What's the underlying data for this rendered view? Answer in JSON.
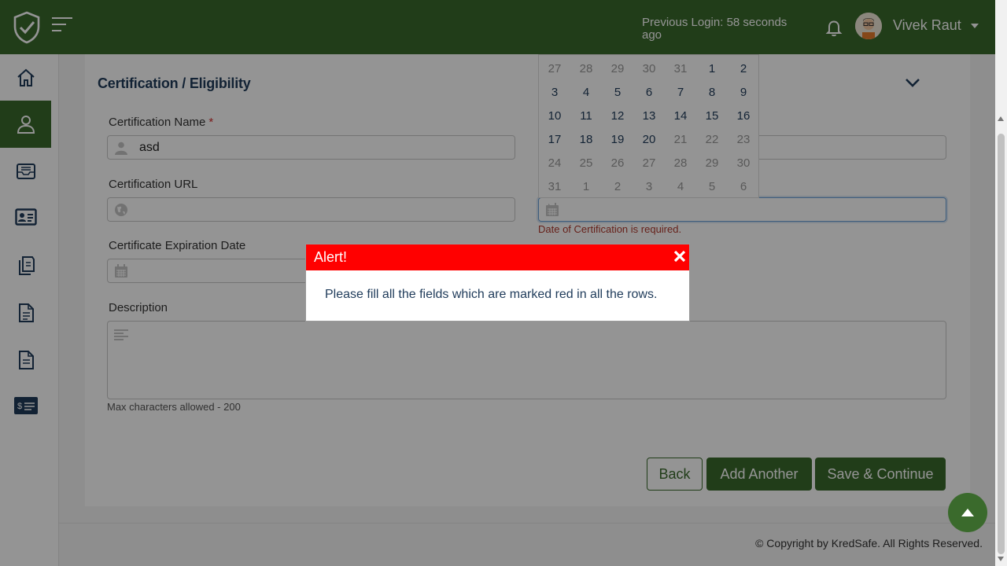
{
  "header": {
    "prev_login": "Previous Login: 58 seconds ago",
    "user_name": "Vivek Raut",
    "brand_color": "#3a6a2c"
  },
  "sidebar": {
    "items": [
      {
        "icon": "home-icon"
      },
      {
        "icon": "user-icon",
        "active": true
      },
      {
        "icon": "inbox-icon"
      },
      {
        "icon": "id-card-icon"
      },
      {
        "icon": "documents-icon"
      },
      {
        "icon": "document-icon"
      },
      {
        "icon": "document-alt-icon"
      },
      {
        "icon": "payment-icon"
      }
    ]
  },
  "section": {
    "title": "Certification / Eligibility"
  },
  "form": {
    "cert_name_label": "Certification Name",
    "required_mark": "*",
    "cert_name_value": "asd",
    "cert_url_label": "Certification URL",
    "expiration_label": "Certificate Expiration Date",
    "date_error": "Date of Certification is required.",
    "description_label": "Description",
    "max_chars_hint": "Max characters allowed - 200"
  },
  "calendar": {
    "weeks": [
      [
        "27",
        "28",
        "29",
        "30",
        "31",
        "1",
        "2"
      ],
      [
        "3",
        "4",
        "5",
        "6",
        "7",
        "8",
        "9"
      ],
      [
        "10",
        "11",
        "12",
        "13",
        "14",
        "15",
        "16"
      ],
      [
        "17",
        "18",
        "19",
        "20",
        "21",
        "22",
        "23"
      ],
      [
        "24",
        "25",
        "26",
        "27",
        "28",
        "29",
        "30"
      ],
      [
        "31",
        "1",
        "2",
        "3",
        "4",
        "5",
        "6"
      ]
    ]
  },
  "buttons": {
    "back": "Back",
    "add_another": "Add Another",
    "save_continue": "Save & Continue"
  },
  "footer": {
    "copyright": "© Copyright by KredSafe. All Rights Reserved."
  },
  "alert": {
    "title": "Alert!",
    "message": "Please fill all the fields which are marked red in all the rows.",
    "header_color": "#ff0000"
  }
}
